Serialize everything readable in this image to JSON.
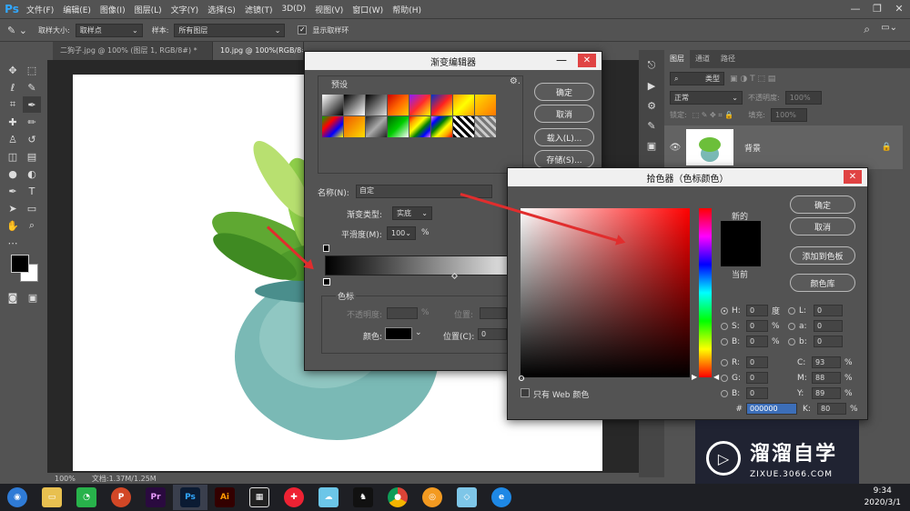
{
  "menubar": {
    "logo": "Ps",
    "items": [
      "文件(F)",
      "编辑(E)",
      "图像(I)",
      "图层(L)",
      "文字(Y)",
      "选择(S)",
      "滤镜(T)",
      "3D(D)",
      "视图(V)",
      "窗口(W)",
      "帮助(H)"
    ],
    "min": "—",
    "max": "❐",
    "close": "✕"
  },
  "options": {
    "sample_size_label": "取样大小:",
    "sample_size": "取样点",
    "sample_label": "样本:",
    "sample": "所有图层",
    "show_ring": "显示取样环"
  },
  "tabs": [
    "二狗子.jpg @ 100% (图层 1, RGB/8#) *",
    "10.jpg @ 100%(RGB/8#)"
  ],
  "status": {
    "zoom": "100%",
    "doc": "文档:1.37M/1.25M"
  },
  "layers": {
    "tabs": [
      "图层",
      "通道",
      "路径"
    ],
    "filter": "类型",
    "blend": "正常",
    "opacity_label": "不透明度:",
    "opacity": "100%",
    "lock_label": "锁定:",
    "fill_label": "填充:",
    "fill": "100%",
    "layer_name": "背景"
  },
  "gradient_editor": {
    "title": "渐变编辑器",
    "presets": "预设",
    "ok": "确定",
    "cancel": "取消",
    "load": "载入(L)...",
    "save": "存储(S)...",
    "name_label": "名称(N):",
    "name": "自定",
    "type_label": "渐变类型:",
    "type": "实底",
    "smooth_label": "平滑度(M):",
    "smooth": "100",
    "pct": "%",
    "stops": "色标",
    "opacity_label": "不透明度:",
    "position_label": "位置:",
    "color_label": "颜色:",
    "position_c_label": "位置(C):",
    "position_c": "0"
  },
  "color_picker": {
    "title": "拾色器（色标颜色）",
    "ok": "确定",
    "cancel": "取消",
    "add": "添加到色板",
    "lib": "颜色库",
    "new": "新的",
    "current": "当前",
    "web": "只有 Web 颜色",
    "H": "0",
    "S": "0",
    "Bv": "0",
    "R": "0",
    "G": "0",
    "B": "0",
    "L": "0",
    "a": "0",
    "b": "0",
    "C": "93",
    "M": "88",
    "Y": "89",
    "K": "80",
    "hex": "000000",
    "deg": "度"
  },
  "watermark": {
    "name": "溜溜自学",
    "url": "ZIXUE.3066.COM"
  },
  "taskbar": {
    "time": "9:34",
    "date": "2020/3/1"
  },
  "colors": {
    "accent": "#e12d2d",
    "hex_highlight": "#3c6eb8"
  }
}
